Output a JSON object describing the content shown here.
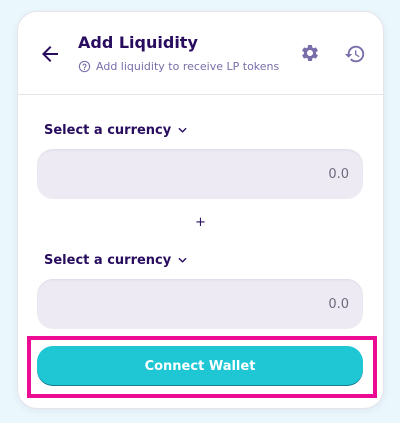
{
  "header": {
    "title": "Add Liquidity",
    "subtitle": "Add liquidity to receive LP tokens",
    "icons": [
      "back-arrow-icon",
      "help-icon",
      "gear-icon",
      "history-icon"
    ]
  },
  "inputs": [
    {
      "select_label": "Select a currency",
      "placeholder": "0.0"
    },
    {
      "select_label": "Select a currency",
      "placeholder": "0.0"
    }
  ],
  "separator": "+",
  "connect_button": {
    "label": "Connect Wallet"
  },
  "colors": {
    "background": "#eaf7fc",
    "primary_text": "#280d5f",
    "secondary_text": "#7a6eaa",
    "input_bg": "#eeeaf4",
    "button": "#1fc7d4",
    "highlight_border": "#ec0c93"
  }
}
